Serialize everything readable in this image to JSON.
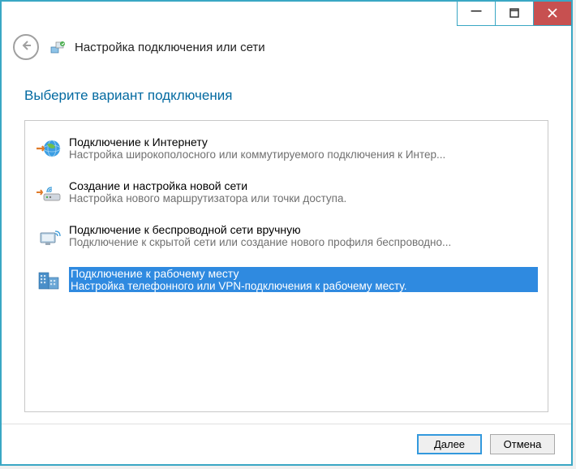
{
  "titlebar": {
    "minimize": "−",
    "maximize": "▢",
    "close": "✕"
  },
  "header": {
    "back": "←",
    "title": "Настройка подключения или сети"
  },
  "heading": "Выберите вариант подключения",
  "options": [
    {
      "title": "Подключение к Интернету",
      "desc": "Настройка широкополосного или коммутируемого подключения к Интер...",
      "selected": false,
      "icon": "internet"
    },
    {
      "title": "Создание и настройка новой сети",
      "desc": "Настройка нового маршрутизатора или точки доступа.",
      "selected": false,
      "icon": "router"
    },
    {
      "title": "Подключение к беспроводной сети вручную",
      "desc": "Подключение к скрытой сети или создание нового профиля беспроводно...",
      "selected": false,
      "icon": "wireless"
    },
    {
      "title": "Подключение к рабочему месту",
      "desc": "Настройка телефонного или VPN-подключения к рабочему месту.",
      "selected": true,
      "icon": "workplace"
    }
  ],
  "footer": {
    "next": "Далее",
    "next_hotkey": "Д",
    "cancel": "Отмена"
  }
}
